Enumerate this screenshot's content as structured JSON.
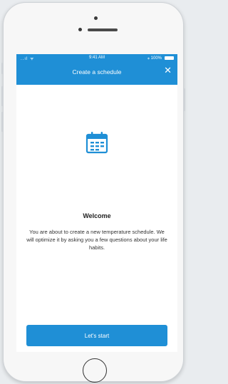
{
  "status_bar": {
    "signal": "..ıl ᯤ",
    "time": "9:41 AM",
    "battery": "⁎ 100%"
  },
  "header": {
    "title": "Create a schedule",
    "close_glyph": "✕"
  },
  "icon": "calendar-icon",
  "content": {
    "heading": "Welcome",
    "description": "You are about to create a new temperature schedule. We will optimize it by asking you a few questions about your life habits."
  },
  "actions": {
    "start_label": "Let's start"
  },
  "colors": {
    "accent": "#1f8fd6",
    "background": "#ffffff"
  }
}
